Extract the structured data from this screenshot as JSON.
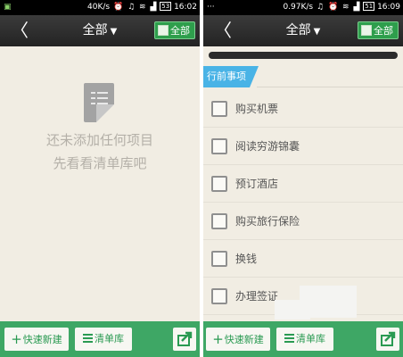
{
  "left_screen": {
    "status_bar": {
      "speed": "40K/s",
      "battery": "53",
      "time": "16:02"
    },
    "nav": {
      "back_icon": "chevron-left-icon",
      "title": "全部",
      "all_button_label": "全部"
    },
    "empty_state": {
      "line1": "还未添加任何项目",
      "line2": "先看看清单库吧"
    },
    "toolbar": {
      "new_label": "快速新建",
      "library_label": "清单库",
      "share_icon": "share-icon"
    }
  },
  "right_screen": {
    "status_bar": {
      "speed": "0.97K/s",
      "battery": "51",
      "time": "16:09"
    },
    "nav": {
      "back_icon": "chevron-left-icon",
      "title": "全部",
      "all_button_label": "全部"
    },
    "progress": {
      "value_fraction": 0.0
    },
    "section_title": "行前事项",
    "items": [
      {
        "label": "购买机票",
        "checked": false
      },
      {
        "label": "阅读穷游锦囊",
        "checked": false
      },
      {
        "label": "预订酒店",
        "checked": false
      },
      {
        "label": "购买旅行保险",
        "checked": false
      },
      {
        "label": "换钱",
        "checked": false
      },
      {
        "label": "办理签证",
        "checked": false
      }
    ],
    "toolbar": {
      "new_label": "快速新建",
      "library_label": "清单库",
      "share_icon": "share-icon"
    }
  },
  "colors": {
    "green": "#3ea765",
    "blue_tab": "#49b3e6",
    "background": "#f1ede3",
    "nav_dark": "#2a2a2a"
  }
}
